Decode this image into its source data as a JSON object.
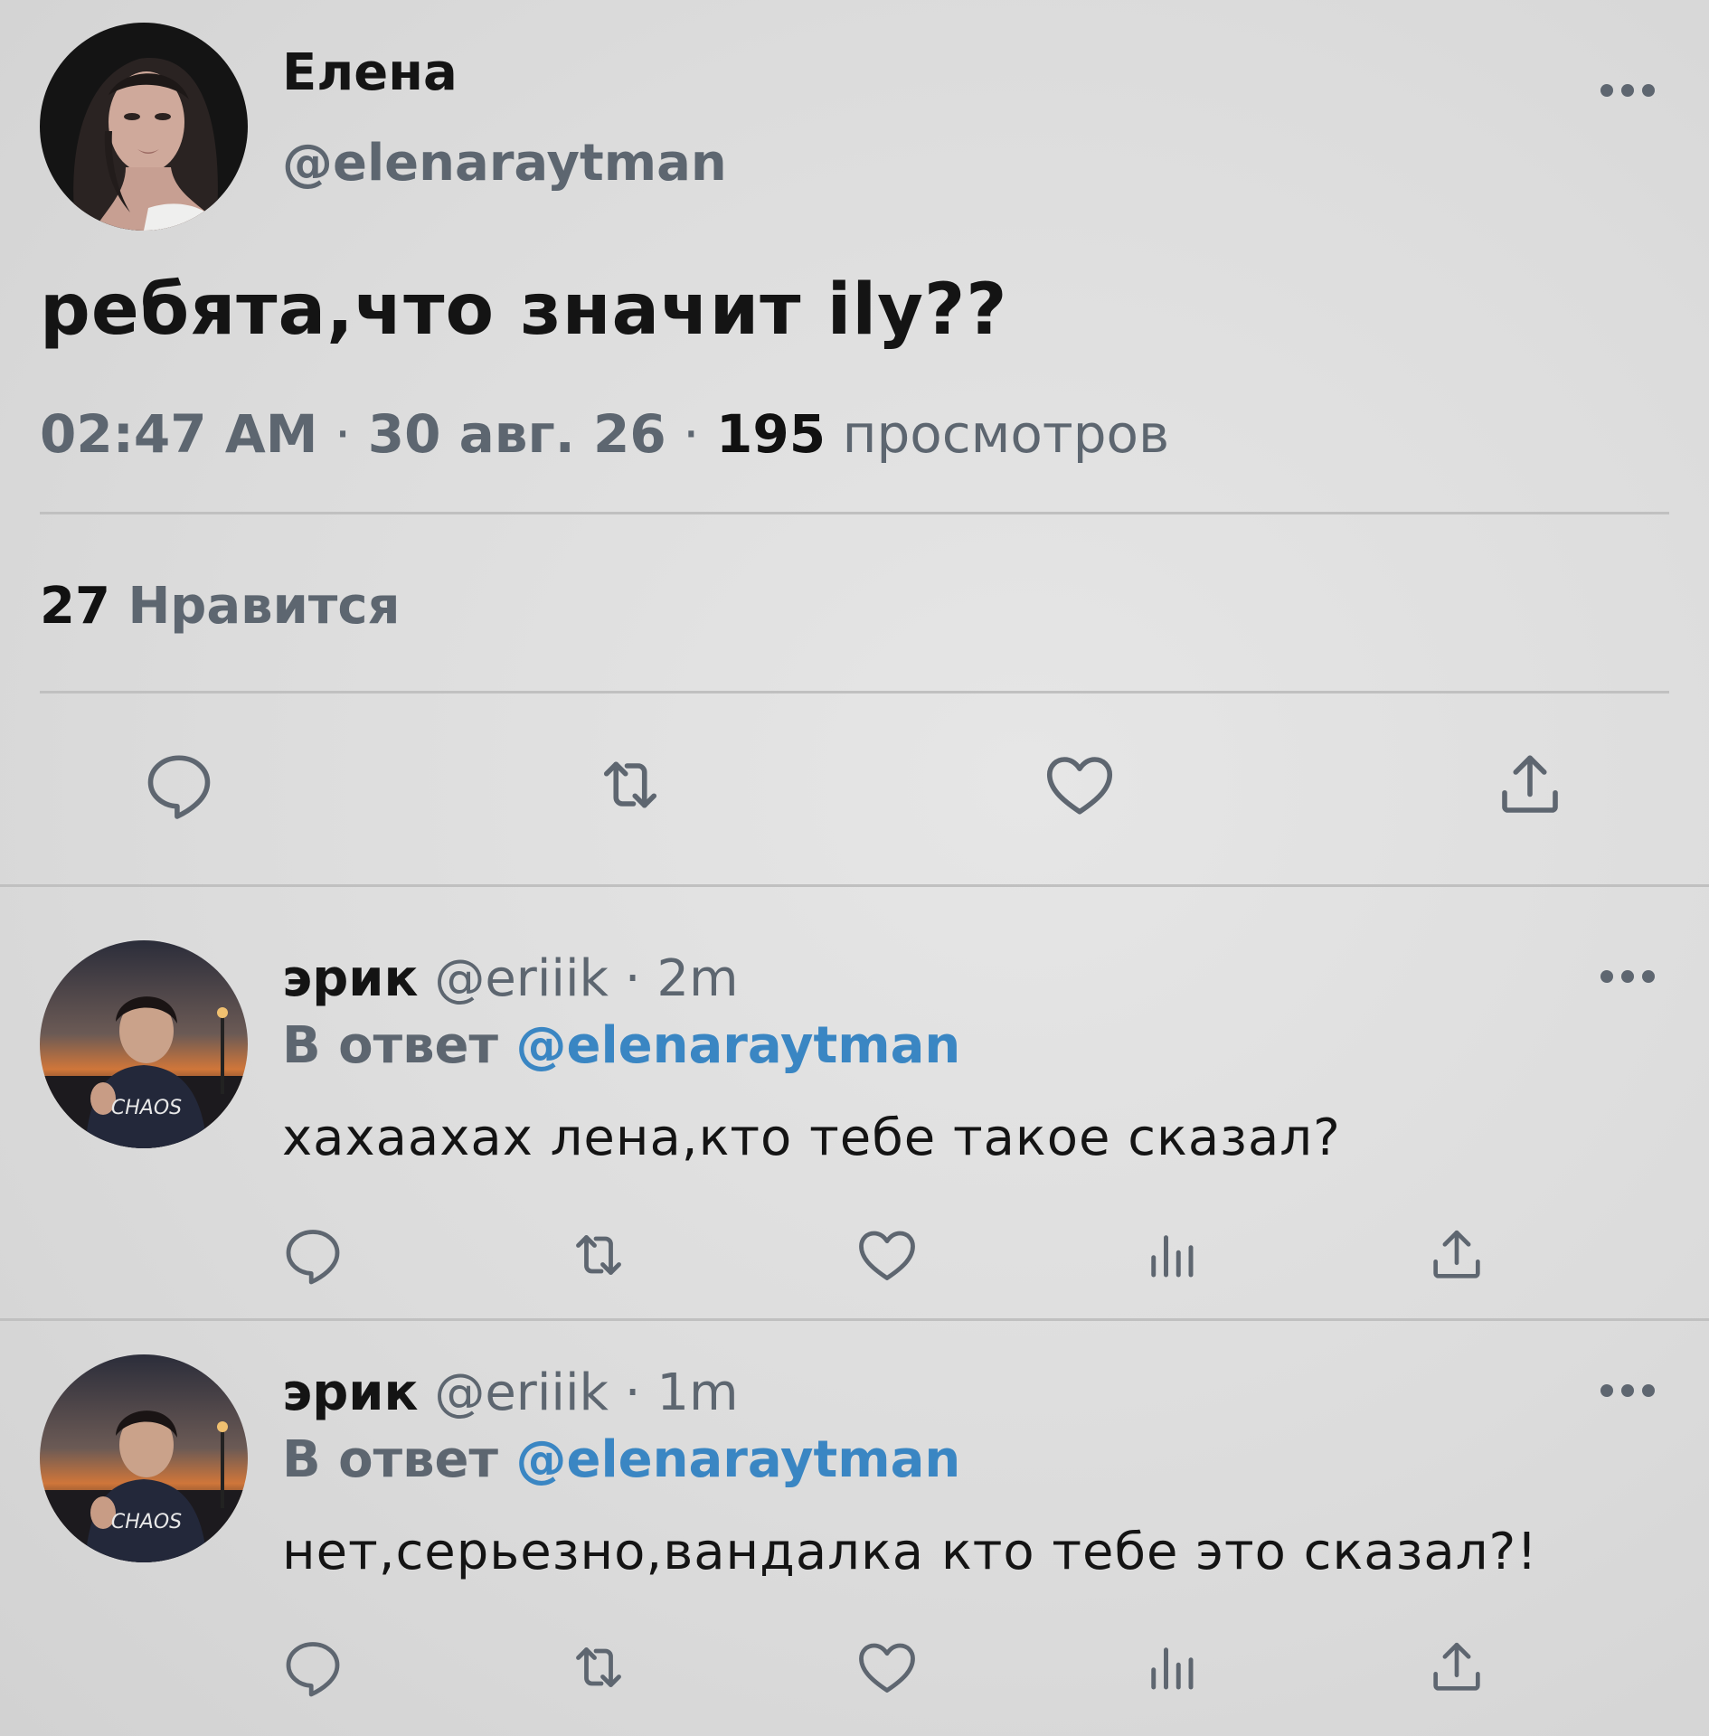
{
  "main_tweet": {
    "author_name": "Елена",
    "author_handle": "@elenaraytman",
    "text": "ребята,что значит ilу??",
    "time": "02:47 AM",
    "date": "30 авг. 26",
    "views_count": "195",
    "views_label": "просмотров",
    "separator": "·",
    "likes_count": "27",
    "likes_label": "Нравится",
    "actions": [
      "comment-icon",
      "retweet-icon",
      "heart-icon",
      "share-icon"
    ]
  },
  "replies": [
    {
      "author_name": "эрик",
      "author_handle": "@eriiik",
      "time_ago": "· 2m",
      "reply_prefix": "В ответ",
      "reply_to": "@elenaraytman",
      "text": "хахаахах лена,кто тебе такое сказал?",
      "actions": [
        "comment-icon",
        "retweet-icon",
        "heart-icon",
        "analytics-icon",
        "share-icon"
      ]
    },
    {
      "author_name": "эрик",
      "author_handle": "@eriiik",
      "time_ago": "· 1m",
      "reply_prefix": "В ответ",
      "reply_to": "@elenaraytman",
      "text": "нет,серьезно,вандалка кто тебе это сказал?!",
      "actions": [
        "comment-icon",
        "retweet-icon",
        "heart-icon",
        "analytics-icon",
        "share-icon"
      ]
    }
  ],
  "avatar_texts": {
    "hoodie_print": "CHAOS"
  },
  "colors": {
    "background": "#dcdcdc",
    "text_primary": "#141414",
    "text_secondary": "#5d6670",
    "mention": "#3a86c3",
    "divider": "#c0c0c0"
  }
}
